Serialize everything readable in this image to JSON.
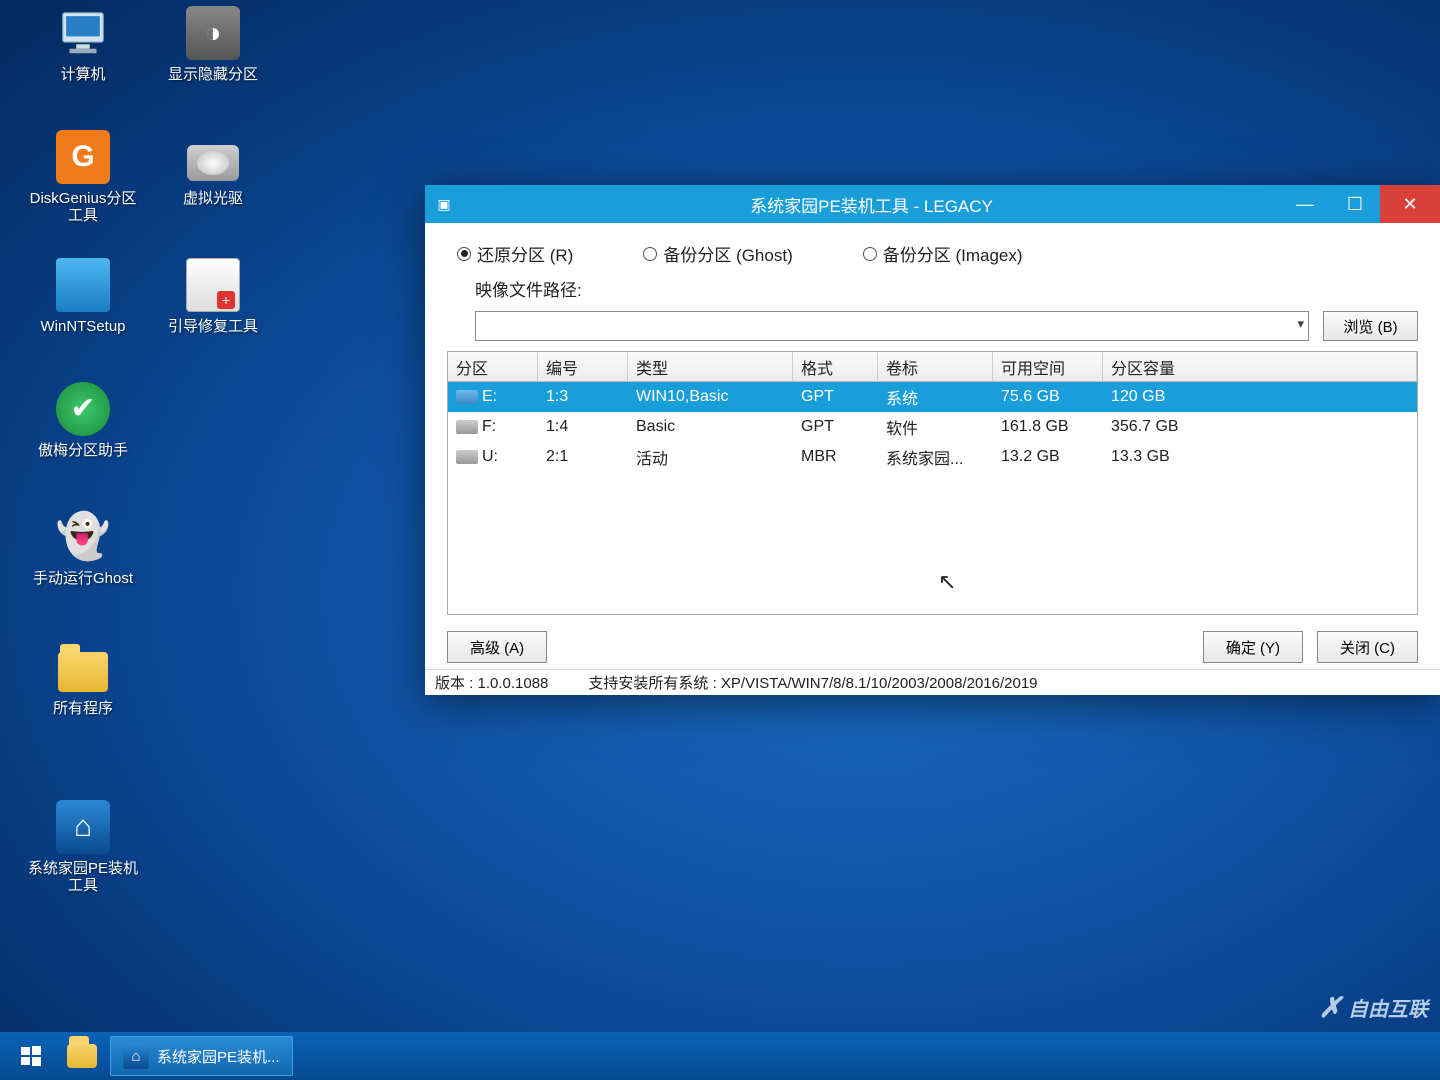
{
  "desktop_icons": {
    "computer": "计算机",
    "show_hidden": "显示隐藏分区",
    "diskgenius": "DiskGenius分区工具",
    "vdrive": "虚拟光驱",
    "winntsetup": "WinNTSetup",
    "bootrepair": "引导修复工具",
    "aomei": "傲梅分区助手",
    "ghost": "手动运行Ghost",
    "allprograms": "所有程序",
    "petool": "系统家园PE装机 工具"
  },
  "taskbar": {
    "task1": "系统家园PE装机..."
  },
  "window": {
    "title": "系统家园PE装机工具 - LEGACY",
    "radios": {
      "restore": "还原分区 (R)",
      "backup_ghost": "备份分区 (Ghost)",
      "backup_imagex": "备份分区 (Imagex)"
    },
    "path_label": "映像文件路径:",
    "browse": "浏览 (B)",
    "headers": {
      "partition": "分区",
      "number": "编号",
      "type": "类型",
      "format": "格式",
      "label": "卷标",
      "free": "可用空间",
      "capacity": "分区容量"
    },
    "rows": [
      {
        "drive": "E:",
        "num": "1:3",
        "type": "WIN10,Basic",
        "fmt": "GPT",
        "label": "系统",
        "free": "75.6 GB",
        "cap": "120 GB",
        "sel": true,
        "gray": false
      },
      {
        "drive": "F:",
        "num": "1:4",
        "type": "Basic",
        "fmt": "GPT",
        "label": "软件",
        "free": "161.8 GB",
        "cap": "356.7 GB",
        "sel": false,
        "gray": true
      },
      {
        "drive": "U:",
        "num": "2:1",
        "type": "活动",
        "fmt": "MBR",
        "label": "系统家园...",
        "free": "13.2 GB",
        "cap": "13.3 GB",
        "sel": false,
        "gray": true
      }
    ],
    "buttons": {
      "advanced": "高级 (A)",
      "ok": "确定 (Y)",
      "close": "关闭 (C)"
    },
    "status": {
      "version": "版本 : 1.0.0.1088",
      "support": "支持安装所有系统 : XP/VISTA/WIN7/8/8.1/10/2003/2008/2016/2019"
    }
  },
  "watermark": "自由互联"
}
